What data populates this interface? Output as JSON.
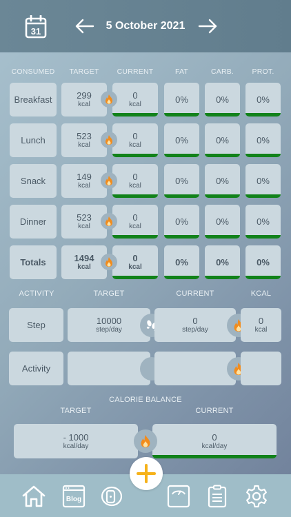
{
  "header": {
    "date": "5 October 2021",
    "calendar_day": "31"
  },
  "meals_table": {
    "headers": [
      "CONSUMED",
      "TARGET",
      "CURRENT",
      "FAT",
      "CARB.",
      "PROT."
    ],
    "rows": [
      {
        "name": "Breakfast",
        "target": "299",
        "target_unit": "kcal",
        "current": "0",
        "current_unit": "kcal",
        "fat": "0%",
        "carb": "0%",
        "prot": "0%"
      },
      {
        "name": "Lunch",
        "target": "523",
        "target_unit": "kcal",
        "current": "0",
        "current_unit": "kcal",
        "fat": "0%",
        "carb": "0%",
        "prot": "0%"
      },
      {
        "name": "Snack",
        "target": "149",
        "target_unit": "kcal",
        "current": "0",
        "current_unit": "kcal",
        "fat": "0%",
        "carb": "0%",
        "prot": "0%"
      },
      {
        "name": "Dinner",
        "target": "523",
        "target_unit": "kcal",
        "current": "0",
        "current_unit": "kcal",
        "fat": "0%",
        "carb": "0%",
        "prot": "0%"
      },
      {
        "name": "Totals",
        "target": "1494",
        "target_unit": "kcal",
        "current": "0",
        "current_unit": "kcal",
        "fat": "0%",
        "carb": "0%",
        "prot": "0%"
      }
    ]
  },
  "activity_table": {
    "headers": [
      "ACTIVITY",
      "TARGET",
      "CURRENT",
      "KCAL"
    ],
    "step": {
      "label": "Step",
      "target": "10000",
      "target_unit": "step/day",
      "current": "0",
      "current_unit": "step/day",
      "kcal": "0",
      "kcal_unit": "kcal"
    },
    "activity": {
      "label": "Activity"
    }
  },
  "calorie_balance": {
    "title": "CALORIE BALANCE",
    "target_header": "TARGET",
    "current_header": "CURRENT",
    "target": "- 1000",
    "target_unit": "kcal/day",
    "current": "0",
    "current_unit": "kcal/day"
  },
  "nav": {
    "blog_label": "Blog",
    "icons": [
      "home-icon",
      "blog-icon",
      "fitness-band-icon",
      "add-icon",
      "scale-icon",
      "clipboard-icon",
      "settings-icon"
    ]
  },
  "colors": {
    "header_bg": "#617d8d",
    "cell_bg": "#cbd8df",
    "progress_green": "#11821a",
    "flame_orange": "#f28c1c",
    "plus_accent": "#f6b21a"
  }
}
